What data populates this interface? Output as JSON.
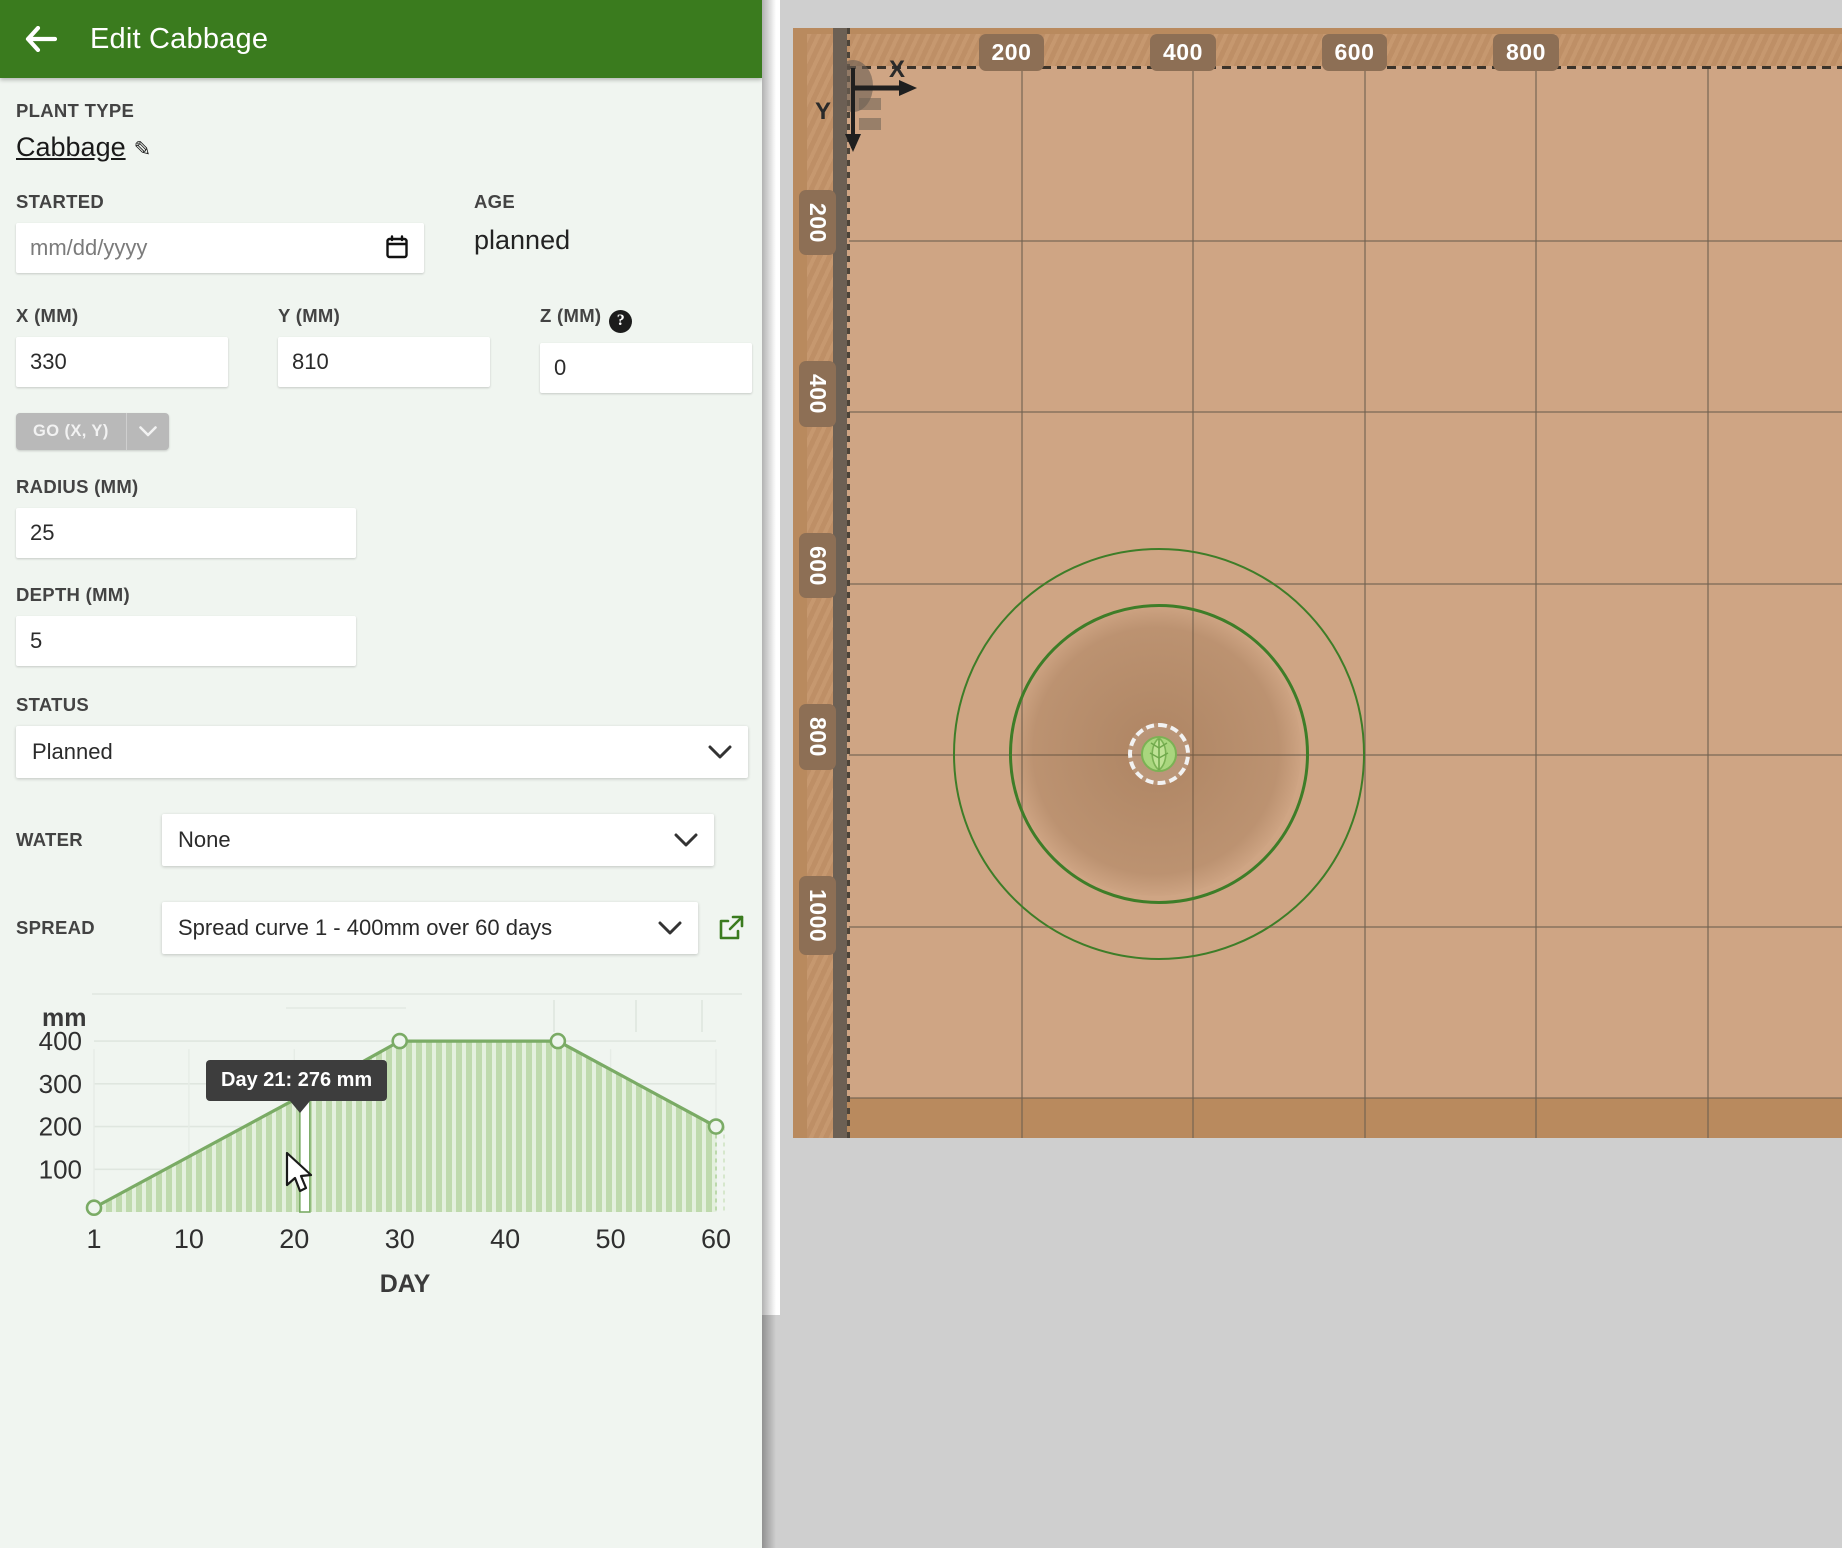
{
  "header": {
    "title": "Edit Cabbage",
    "back_icon": "arrow-left-icon",
    "bg_color": "#3a7b1e"
  },
  "form": {
    "plant_type_label": "PLANT TYPE",
    "plant_type_value": "Cabbage",
    "edit_icon": "pencil-icon",
    "started_label": "STARTED",
    "started_placeholder": "mm/dd/yyyy",
    "started_value": "",
    "age_label": "AGE",
    "age_value": "planned",
    "x_label": "X (MM)",
    "x_value": "330",
    "y_label": "Y (MM)",
    "y_value": "810",
    "z_label": "Z (MM)",
    "z_value": "0",
    "z_help_icon": "help-circle-icon",
    "go_button_label": "GO (X, Y)",
    "go_caret_icon": "chevron-down-icon",
    "radius_label": "RADIUS (MM)",
    "radius_value": "25",
    "depth_label": "DEPTH (MM)",
    "depth_value": "5",
    "status_label": "STATUS",
    "status_value": "Planned",
    "water_label": "WATER",
    "water_value": "None",
    "spread_label": "SPREAD",
    "spread_value": "Spread curve 1 - 400mm over 60 days",
    "spread_external_icon": "external-link-icon",
    "select_caret_icon": "chevron-down-icon"
  },
  "chart_data": {
    "type": "area",
    "title": "",
    "xlabel": "DAY",
    "ylabel": "mm",
    "x": [
      1,
      21,
      30,
      45,
      60
    ],
    "values": [
      10,
      276,
      400,
      400,
      200
    ],
    "xticks": [
      1,
      10,
      20,
      30,
      40,
      50,
      60
    ],
    "yticks": [
      100,
      200,
      300,
      400
    ],
    "xlim": [
      1,
      60
    ],
    "ylim": [
      0,
      440
    ],
    "grid": true,
    "legend": "none",
    "markers_at": [
      1,
      30,
      45,
      60
    ],
    "line_color": "#7aab65",
    "fill_color": "#bcd9ab",
    "tooltip": "Day 21: 276 mm",
    "tooltip_day": 21,
    "tooltip_value": 276
  },
  "map": {
    "x_axis_letter": "X",
    "y_axis_letter": "Y",
    "x_ruler": [
      "200",
      "400",
      "600",
      "800"
    ],
    "y_ruler": [
      "200",
      "400",
      "600",
      "800",
      "1000"
    ],
    "plant_icon": "cabbage-plant-icon",
    "gantry_icon": "gantry-icon",
    "soil_color": "#cfa584",
    "bed_color": "#b98a5e",
    "spread_circle_color": "#3e7d28"
  }
}
